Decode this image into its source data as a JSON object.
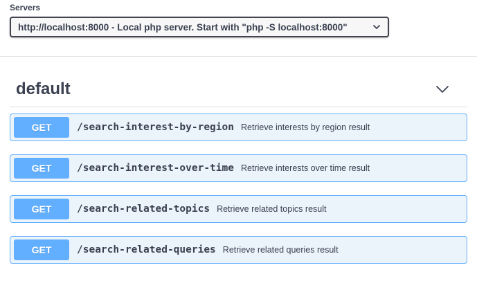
{
  "servers": {
    "label": "Servers",
    "selected": "http://localhost:8000 - Local php server. Start with \"php -S localhost:8000\""
  },
  "section": {
    "title": "default"
  },
  "operations": [
    {
      "method": "GET",
      "path": "/search-interest-by-region",
      "summary": "Retrieve interests by region result"
    },
    {
      "method": "GET",
      "path": "/search-interest-over-time",
      "summary": "Retrieve interests over time result"
    },
    {
      "method": "GET",
      "path": "/search-related-topics",
      "summary": "Retrieve related topics result"
    },
    {
      "method": "GET",
      "path": "/search-related-queries",
      "summary": "Retrieve related queries result"
    }
  ],
  "colors": {
    "get_method": "#61affe",
    "get_background": "#ebf3fb",
    "text": "#3b4151"
  }
}
